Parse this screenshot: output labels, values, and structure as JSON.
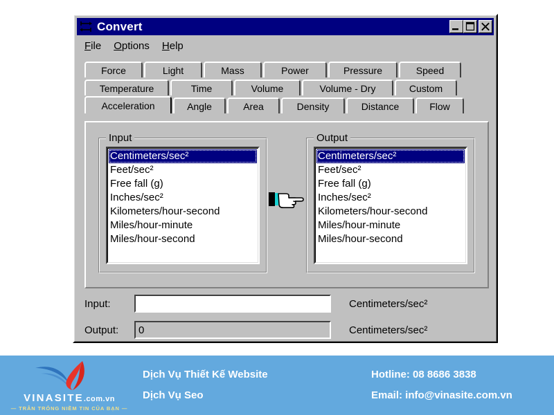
{
  "window": {
    "title": "Convert",
    "icon": "convert-arrows-icon",
    "title_bg": "#000080",
    "face": "#c0c0c0",
    "buttons": [
      {
        "name": "minimize-button",
        "glyph": "minimize"
      },
      {
        "name": "maximize-button",
        "glyph": "maximize"
      },
      {
        "name": "close-button",
        "glyph": "close"
      }
    ]
  },
  "menu": {
    "items": [
      {
        "accel": "F",
        "rest": "ile"
      },
      {
        "accel": "O",
        "rest": "ptions"
      },
      {
        "accel": "H",
        "rest": "elp"
      }
    ]
  },
  "tabs": {
    "active": "Acceleration",
    "rows": [
      [
        "Force",
        "Light",
        "Mass",
        "Power",
        "Pressure",
        "Speed"
      ],
      [
        "Temperature",
        "Time",
        "Volume",
        "Volume - Dry",
        "Custom"
      ],
      [
        "Acceleration",
        "Angle",
        "Area",
        "Density",
        "Distance",
        "Flow"
      ]
    ]
  },
  "panel": {
    "input_group": {
      "label": "Input",
      "selected_index": 0,
      "items": [
        "Centimeters/sec²",
        "Feet/sec²",
        "Free fall (g)",
        "Inches/sec²",
        "Kilometers/hour-second",
        "Miles/hour-minute",
        "Miles/hour-second"
      ]
    },
    "output_group": {
      "label": "Output",
      "selected_index": 0,
      "items": [
        "Centimeters/sec²",
        "Feet/sec²",
        "Free fall (g)",
        "Inches/sec²",
        "Kilometers/hour-second",
        "Miles/hour-minute",
        "Miles/hour-second"
      ]
    },
    "divider_icon": "pointing-hand-icon",
    "selection_color": "#000080"
  },
  "fields": {
    "input": {
      "label": "Input:",
      "value": "",
      "placeholder": "",
      "unit": "Centimeters/sec²"
    },
    "output": {
      "label": "Output:",
      "value": "0",
      "unit": "Centimeters/sec²"
    }
  },
  "banner": {
    "bg": "#63a9de",
    "logo": {
      "name": "VINASITE",
      "domain": ".com.vn",
      "tagline": "— TRÂN TRỎNG NIỀM TIN CỦA BẠN —",
      "mark": "vinasite-logo-icon",
      "swoosh_color": "#2f74bd",
      "flame_color": "#e8342a",
      "tagline_color": "#f2e08a"
    },
    "services": [
      "Dịch Vụ Thiết Kế Website",
      "Dịch Vụ Seo"
    ],
    "contact": [
      "Hotline: 08 8686 3838",
      "Email: info@vinasite.com.vn"
    ]
  }
}
